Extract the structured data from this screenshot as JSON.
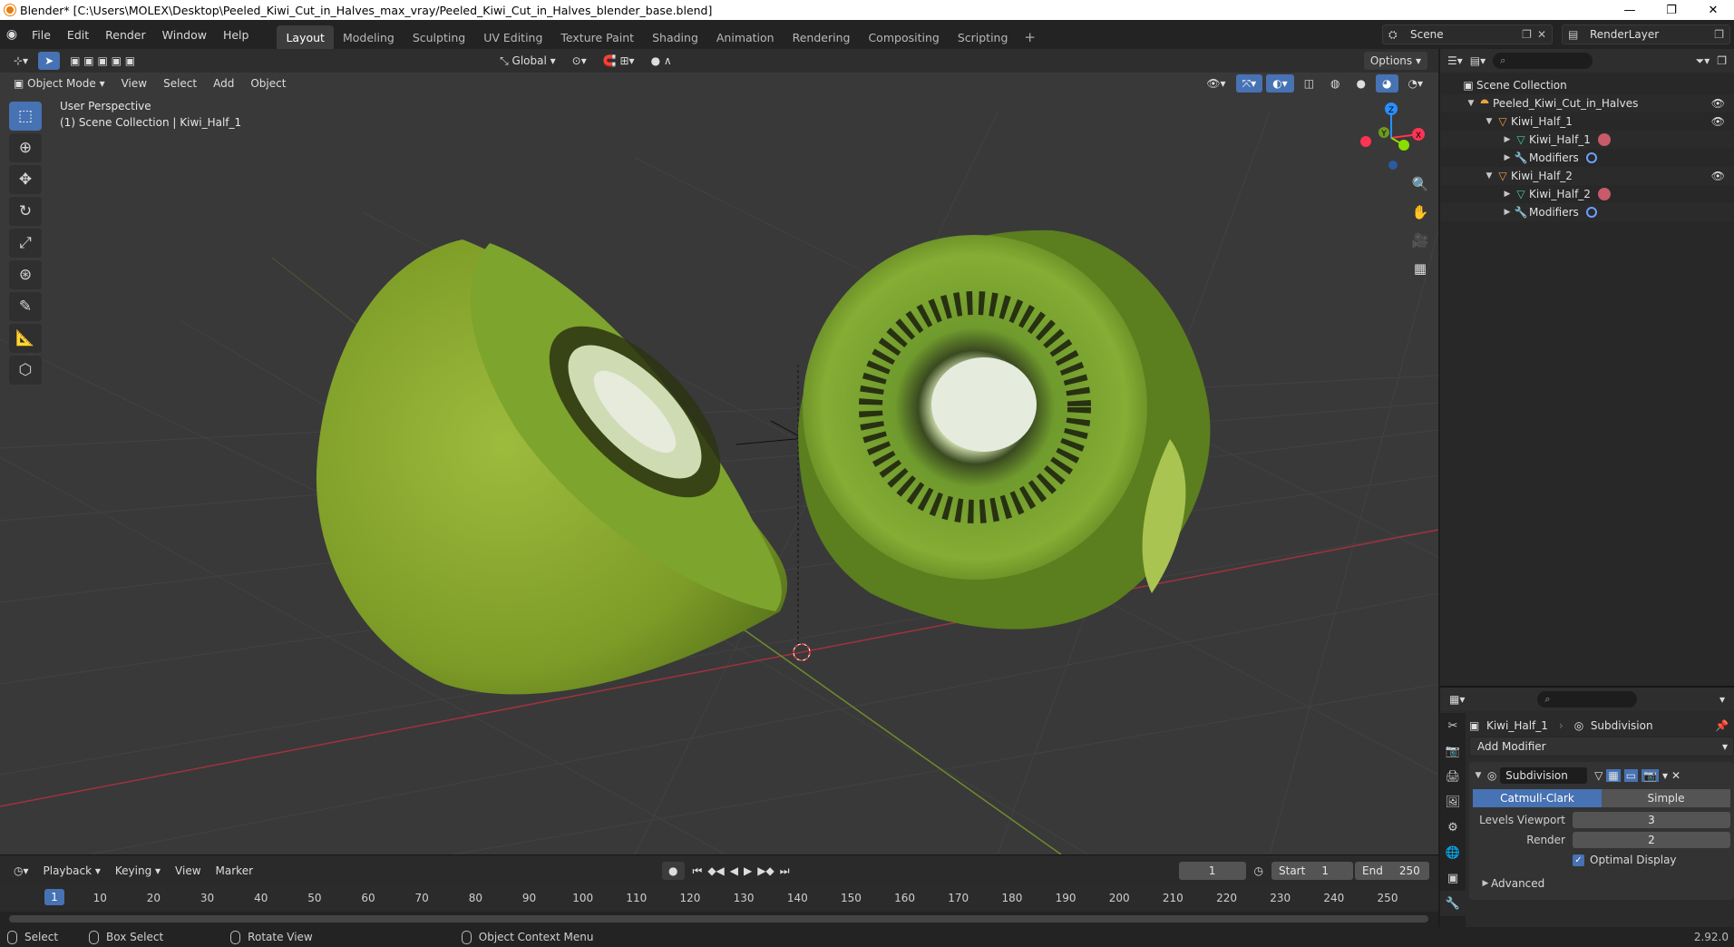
{
  "window": {
    "title": "Blender* [C:\\Users\\MOLEX\\Desktop\\Peeled_Kiwi_Cut_in_Halves_max_vray/Peeled_Kiwi_Cut_in_Halves_blender_base.blend]",
    "minimize": "—",
    "maximize": "❐",
    "close": "✕"
  },
  "menu": [
    "File",
    "Edit",
    "Render",
    "Window",
    "Help"
  ],
  "workspaces": [
    "Layout",
    "Modeling",
    "Sculpting",
    "UV Editing",
    "Texture Paint",
    "Shading",
    "Animation",
    "Rendering",
    "Compositing",
    "Scripting"
  ],
  "workspace_add": "+",
  "scene": {
    "name": "Scene",
    "render_layer": "RenderLayer"
  },
  "viewport": {
    "mode": "Object Mode",
    "menus": [
      "View",
      "Select",
      "Add",
      "Object"
    ],
    "transform_orientation": "Global",
    "options_label": "Options",
    "overlay_line1": "User Perspective",
    "overlay_line2": "(1) Scene Collection | Kiwi_Half_1",
    "gizmo_axes": {
      "x": "X",
      "y": "Y",
      "z": "Z"
    },
    "colors": {
      "x_axis": "#ff3352",
      "y_axis": "#8bdc00",
      "z_axis": "#2890ff",
      "selection": "#4772b3"
    }
  },
  "tools": [
    "select-box",
    "cursor",
    "move",
    "rotate",
    "scale",
    "transform",
    "annotate",
    "measure",
    "add-cube"
  ],
  "timeline": {
    "menus": [
      "Playback",
      "Keying",
      "View",
      "Marker"
    ],
    "current_frame": "1",
    "start_label": "Start",
    "start_value": "1",
    "end_label": "End",
    "end_value": "250",
    "ticks": [
      "1",
      "10",
      "20",
      "30",
      "40",
      "50",
      "60",
      "70",
      "80",
      "90",
      "100",
      "110",
      "120",
      "130",
      "140",
      "150",
      "160",
      "170",
      "180",
      "190",
      "200",
      "210",
      "220",
      "230",
      "240",
      "250"
    ]
  },
  "statusbar": {
    "items": [
      "Select",
      "Box Select",
      "Rotate View",
      "Object Context Menu"
    ],
    "version": "2.92.0"
  },
  "outliner": {
    "root": "Scene Collection",
    "rows": [
      {
        "label": "Peeled_Kiwi_Cut_in_Halves",
        "indent": 1,
        "expanded": true,
        "icon": "collection-icon"
      },
      {
        "label": "Kiwi_Half_1",
        "indent": 2,
        "expanded": true,
        "icon": "object-icon"
      },
      {
        "label": "Kiwi_Half_1",
        "indent": 3,
        "expanded": false,
        "icon": "mesh-icon"
      },
      {
        "label": "Modifiers",
        "indent": 3,
        "expanded": false,
        "icon": "wrench-icon"
      },
      {
        "label": "Kiwi_Half_2",
        "indent": 2,
        "expanded": true,
        "icon": "object-icon"
      },
      {
        "label": "Kiwi_Half_2",
        "indent": 3,
        "expanded": false,
        "icon": "mesh-icon"
      },
      {
        "label": "Modifiers",
        "indent": 3,
        "expanded": false,
        "icon": "wrench-icon"
      }
    ]
  },
  "properties": {
    "object_name": "Kiwi_Half_1",
    "modifier_crumb": "Subdivision",
    "add_modifier": "Add Modifier",
    "modifier_name": "Subdivision",
    "algorithms": [
      "Catmull-Clark",
      "Simple"
    ],
    "levels_viewport_label": "Levels Viewport",
    "levels_viewport_value": "3",
    "render_label": "Render",
    "render_value": "2",
    "optimal_display_label": "Optimal Display",
    "advanced_label": "Advanced"
  }
}
